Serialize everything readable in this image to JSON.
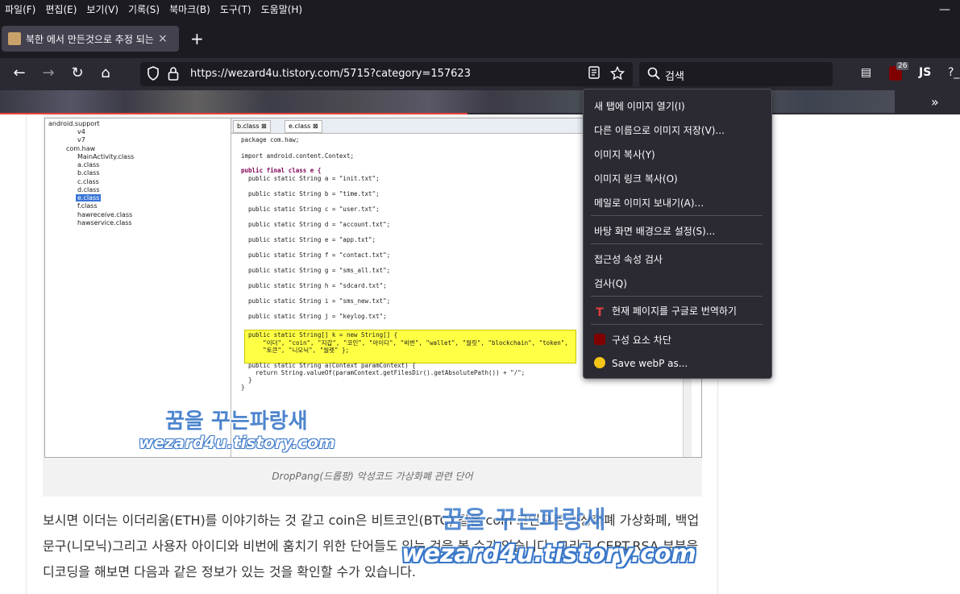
{
  "menubar": {
    "items": [
      "파일(F)",
      "편집(E)",
      "보기(V)",
      "기록(S)",
      "북마크(B)",
      "도구(T)",
      "도움말(H)"
    ],
    "minimize": "—"
  },
  "tab": {
    "title": "북한 에서 만든것으로 추정 되는",
    "close": "×",
    "new_tab": "+"
  },
  "nav": {
    "back": "←",
    "forward": "→",
    "reload": "↻",
    "home": "⌂",
    "url": "https://wezard4u.tistory.com/5715?category=157623",
    "search_placeholder": "검색",
    "ext_badge": "26",
    "ext_js": "JS",
    "ext_more": "?_",
    "sidebar_icon": "▤"
  },
  "bookmarks": {
    "overflow": "»"
  },
  "figure": {
    "tree": [
      "android.support",
      "v4",
      "v7",
      "com.haw",
      "MainActivity.class",
      "a.class",
      "b.class",
      "c.class",
      "d.class",
      "e.class",
      "f.class",
      "hawreceive.class",
      "hawservice.class"
    ],
    "editor_tabs": [
      "b.class ⊠",
      "e.class ⊠"
    ],
    "code": [
      "package com.haw;",
      "",
      "import android.content.Context;",
      "",
      "public final class e {",
      "  public static String a = \"init.txt\";",
      "  public static String b = \"time.txt\";",
      "  public static String c = \"user.txt\";",
      "  public static String d = \"account.txt\";",
      "  public static String e = \"app.txt\";",
      "  public static String f = \"contact.txt\";",
      "  public static String g = \"sms_all.txt\";",
      "  public static String h = \"sdcard.txt\";",
      "  public static String i = \"sms_new.txt\";",
      "  public static String j = \"keylog.txt\";",
      "  public static String[] k = new String[] {",
      "      \"이더\", \"coin\", \"지갑\", \"코인\", \"아이디\", \"비번\", \"wallet\", \"월릿\", \"blockchain\", \"token\",",
      "      \"토큰\", \"니모닉\", \"월렛\" };",
      "  public static String a(Context paramContext) {",
      "    return String.valueOf(paramContext.getFilesDir().getAbsolutePath()) + \"/\";",
      "  }",
      "}"
    ],
    "caption": "DropPang(드롭팡) 악성코드 가상화폐 관련 단어"
  },
  "article": {
    "paragraph": "보시면 이더는 이더리움(ETH)를 이야기하는 것 같고 coin은 비트코인(BTC) 같은 coin 코인으로 가상화폐 가상화폐, 백업 문구(니모닉)그리고 사용자 아이디와 비번에 훔치기 위한 단어들도 있는 것을 볼 수가 있습니다. 그리고 CERT.RSA 부분을 디코딩을 해보면 다음과 같은 정보가 있는 것을 확인할 수가 있습니다."
  },
  "watermark": {
    "korean": "꿈을 꾸는파랑새",
    "url": "wezard4u.tistory.com"
  },
  "context_menu": {
    "items": [
      "새 탭에 이미지 열기(I)",
      "다른 이름으로 이미지 저장(V)...",
      "이미지 복사(Y)",
      "이미지 링크 복사(O)",
      "메일로 이미지 보내기(A)...",
      "바탕 화면 배경으로 설정(S)...",
      "접근성 속성 검사",
      "검사(Q)",
      "현재 페이지를 구글로 번역하기",
      "구성 요소 차단",
      "Save webP as..."
    ]
  },
  "colors": {
    "chrome_dark": "#1c1b22",
    "toolbar": "#2b2a33",
    "menu_bg": "#2b2a33",
    "accent_red": "#e8423a"
  }
}
